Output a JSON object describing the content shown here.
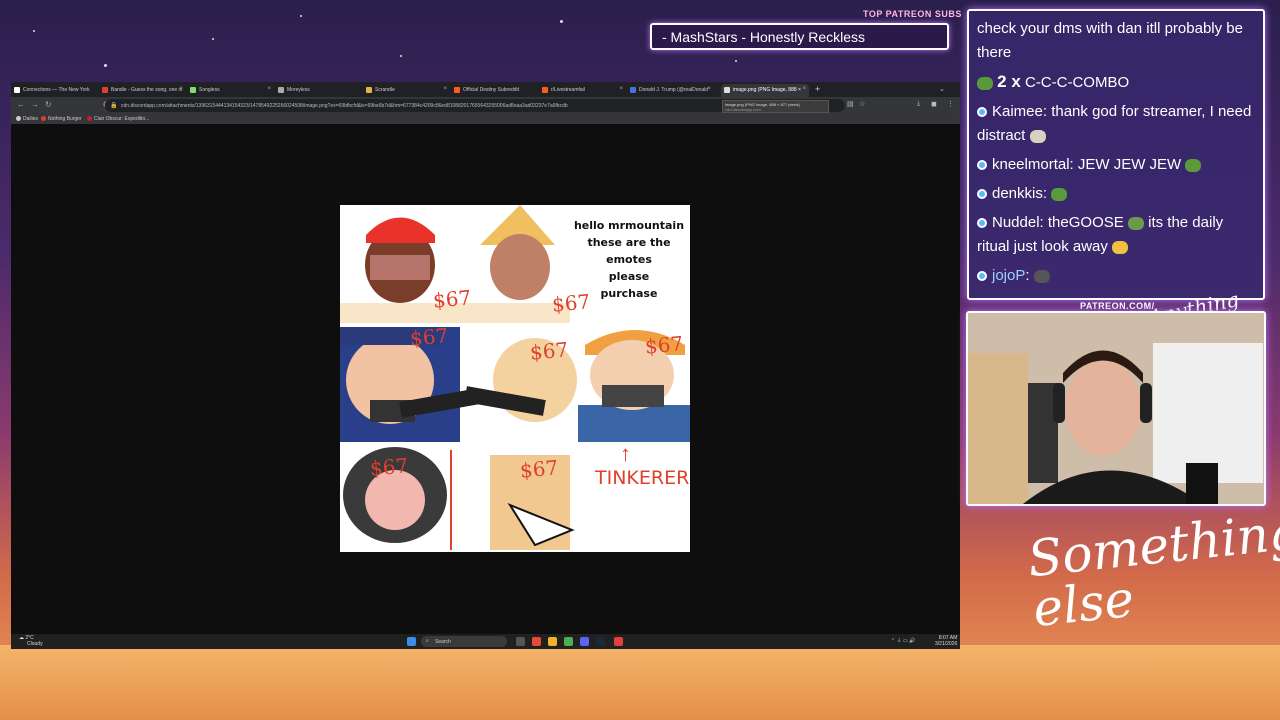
{
  "overlay": {
    "patreon_header": "TOP PATREON SUBS",
    "patreon_ticker": "- MashStars - Honestly Reckless",
    "patreon_tag": "PATREON.COM/",
    "cam_script": "Anything else",
    "logo_text": "Something else"
  },
  "browser": {
    "tabs": [
      {
        "label": "Connections — The New York",
        "color": "#ffffff"
      },
      {
        "label": "Bandle - Guess the song, one in",
        "color": "#e0402a"
      },
      {
        "label": "Songless",
        "color": "#7adf6b"
      },
      {
        "label": "Moreyless",
        "color": "#aaaaaa"
      },
      {
        "label": "Scrandle",
        "color": "#e6b04a"
      },
      {
        "label": "Official Destiny Subreddit",
        "color": "#ff5a1f"
      },
      {
        "label": "r/Livestreamfail",
        "color": "#ff5a1f"
      },
      {
        "label": "Donald J. Trump (@realDonald",
        "color": "#4b6ee0"
      },
      {
        "label": "image.png (PNG Image, 888 ×",
        "color": "#dddddd"
      }
    ],
    "url": "cdn.discordapp.com/attachments/1396315444134154323/1478549225266024508/image.png?ex=69bfbcfd&is=69be6b7d&hm=677384c4209c86ed810882017655643255006ad8eaa3ad03237e7a6fbcdb",
    "tooltip_title": "image.png (PNG Image, 888 × 877 pixels)",
    "tooltip_host": "cdn.discordapp.com",
    "bookmarks": [
      {
        "label": "Dailies",
        "color": "#cccccc"
      },
      {
        "label": "Nothing Burger",
        "color": "#e0402a"
      },
      {
        "label": "Clair Obscur: Expeditio...",
        "color": "#c81e2a"
      }
    ]
  },
  "meme": {
    "caption_lines": [
      "hello mrmountain",
      "these are the",
      "emotes",
      "please",
      "purchase"
    ],
    "price": "$67",
    "tinkerer": "TINKERER"
  },
  "taskbar": {
    "weather_temp": "2°C",
    "weather_desc": "Cloudy",
    "search": "Search",
    "time": "8:07 AM",
    "date": "3/21/2026"
  },
  "chat": {
    "top_message": "check your dms with dan itll probably be there",
    "combo_count": "2 x",
    "combo_label": "C-C-C-COMBO",
    "messages": [
      {
        "user": "Kaimee",
        "text": "thank god for streamer, I need distract"
      },
      {
        "user": "kneelmortal",
        "text": "JEW JEW JEW"
      },
      {
        "user": "denkkis",
        "text": ""
      },
      {
        "user": "Nuddel",
        "text": "theGOOSE",
        "text2": "its the daily ritual just look away"
      },
      {
        "user": "jojoP",
        "text": ""
      }
    ]
  }
}
